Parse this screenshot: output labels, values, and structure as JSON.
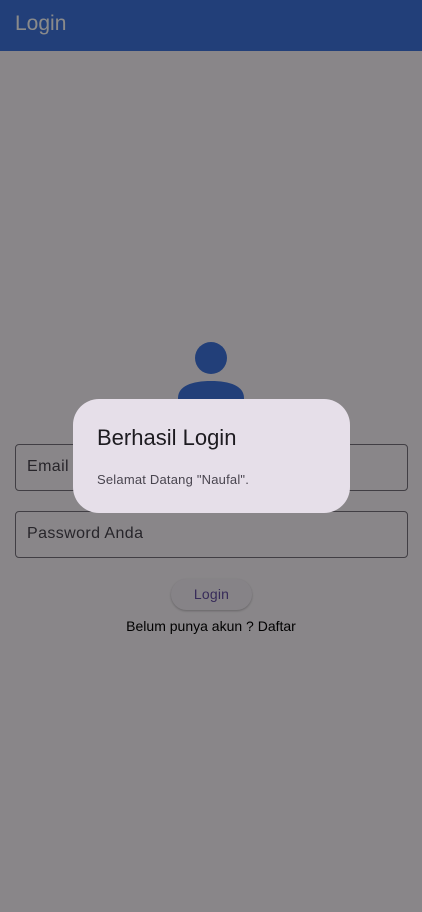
{
  "app_bar": {
    "title": "Login"
  },
  "form": {
    "email_placeholder": "Email Anda",
    "password_placeholder": "Password Anda",
    "login_label": "Login",
    "register_prompt": "Belum punya akun ? Daftar"
  },
  "dialog": {
    "title": "Berhasil Login",
    "message": "Selamat Datang \"Naufal\"."
  },
  "icons": {
    "avatar": "person-icon"
  },
  "colors": {
    "primary": "#3f75e0",
    "dialog_bg": "#e6dfe9",
    "scrim": "rgba(0,0,0,0.46)"
  }
}
